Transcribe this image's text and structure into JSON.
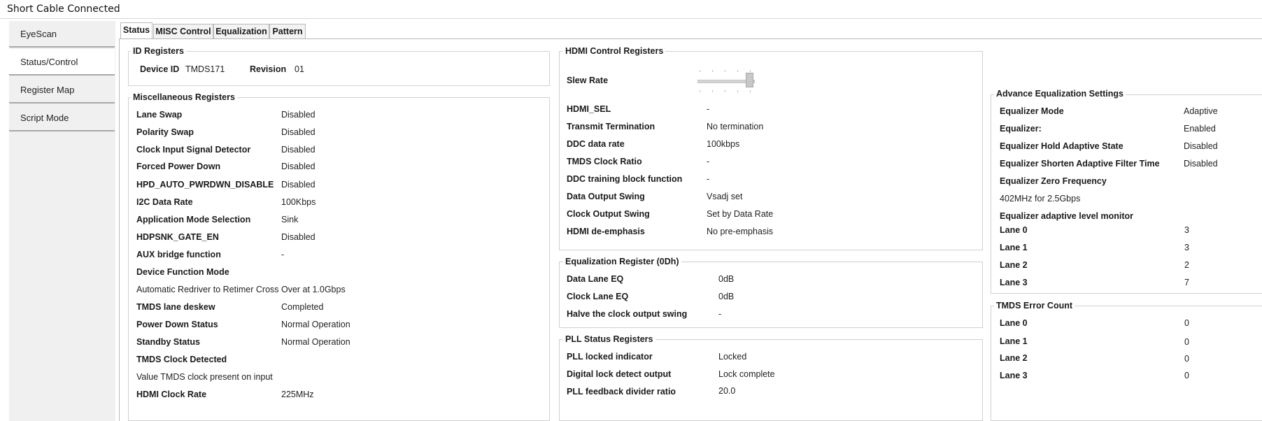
{
  "window": {
    "title": "Short Cable Connected"
  },
  "nav": {
    "items": [
      "EyeScan",
      "Status/Control",
      "Register Map",
      "Script Mode"
    ]
  },
  "tabs": [
    "Status",
    "MISC Control",
    "Equalization",
    "Pattern"
  ],
  "id_registers": {
    "title": "ID Registers",
    "device_id_label": "Device ID",
    "device_id": "TMDS171",
    "revision_label": "Revision",
    "revision": "01"
  },
  "misc": {
    "title": "Miscellaneous Registers",
    "rows": [
      {
        "label": "Lane Swap",
        "value": "Disabled"
      },
      {
        "label": "Polarity Swap",
        "value": "Disabled"
      },
      {
        "label": "Clock Input Signal Detector",
        "value": "Disabled"
      },
      {
        "label": "Forced Power Down",
        "value": "Disabled"
      },
      {
        "label": "HPD_AUTO_PWRDWN_DISABLE",
        "value": "Disabled"
      },
      {
        "label": "I2C Data Rate",
        "value": "100Kbps"
      },
      {
        "label": "Application Mode Selection",
        "value": "Sink"
      },
      {
        "label": "HDPSNK_GATE_EN",
        "value": "Disabled"
      },
      {
        "label": "AUX bridge function",
        "value": "-"
      }
    ],
    "device_function_label": "Device Function Mode",
    "device_function_value": "Automatic Redriver to Retimer Cross Over at 1.0Gbps",
    "rows2": [
      {
        "label": "TMDS lane deskew",
        "value": "Completed"
      },
      {
        "label": "Power Down Status",
        "value": "Normal Operation"
      },
      {
        "label": "Standby Status",
        "value": "Normal Operation"
      }
    ],
    "clock_detected_label": "TMDS Clock Detected",
    "clock_detected_value": "Value TMDS clock present on input",
    "hdmi_clock_rate_label": "HDMI Clock Rate",
    "hdmi_clock_rate_value": "225MHz"
  },
  "hdmi_control": {
    "title": "HDMI Control Registers",
    "slew_rate_label": "Slew Rate",
    "slew_rate_level": 1.0,
    "rows": [
      {
        "label": "HDMI_SEL",
        "value": "-"
      },
      {
        "label": "Transmit Termination",
        "value": "No termination"
      },
      {
        "label": "DDC data rate",
        "value": "100kbps"
      },
      {
        "label": "TMDS Clock Ratio",
        "value": "-"
      },
      {
        "label": "DDC training block function",
        "value": "-"
      },
      {
        "label": "Data Output Swing",
        "value": "Vsadj set"
      },
      {
        "label": "Clock Output Swing",
        "value": "Set by Data Rate"
      },
      {
        "label": "HDMI de-emphasis",
        "value": "No pre-emphasis"
      }
    ]
  },
  "eq_register": {
    "title": "Equalization Register (0Dh)",
    "rows": [
      {
        "label": "Data Lane EQ",
        "value": "0dB"
      },
      {
        "label": "Clock Lane EQ",
        "value": "0dB"
      },
      {
        "label": "Halve the clock output swing",
        "value": "-"
      }
    ]
  },
  "pll": {
    "title": "PLL Status Registers",
    "rows": [
      {
        "label": "PLL locked indicator",
        "value": "Locked"
      },
      {
        "label": "Digital lock detect output",
        "value": "Lock complete"
      },
      {
        "label": "PLL feedback divider ratio",
        "value": "20.0"
      }
    ]
  },
  "adv_eq": {
    "title": "Advance  Equalization Settings",
    "rows": [
      {
        "label": "Equalizer Mode",
        "value": "Adaptive"
      },
      {
        "label": "Equalizer:",
        "value": "Enabled"
      },
      {
        "label": "Equalizer Hold Adaptive State",
        "value": "Disabled"
      },
      {
        "label": "Equalizer Shorten Adaptive Filter Time",
        "value": "Disabled"
      }
    ],
    "zero_freq_label": "Equalizer Zero Frequency",
    "zero_freq_value": "402MHz for 2.5Gbps",
    "monitor_label": "Equalizer adaptive level monitor",
    "lanes": [
      {
        "label": "Lane 0",
        "value": "3"
      },
      {
        "label": "Lane 1",
        "value": "3"
      },
      {
        "label": "Lane 2",
        "value": "2"
      },
      {
        "label": "Lane 3",
        "value": "7"
      }
    ]
  },
  "tmds_error": {
    "title": "TMDS Error Count",
    "lanes": [
      {
        "label": "Lane 0",
        "value": "0"
      },
      {
        "label": "Lane 1",
        "value": "0"
      },
      {
        "label": "Lane 2",
        "value": "0"
      },
      {
        "label": "Lane 3",
        "value": "0"
      }
    ]
  }
}
